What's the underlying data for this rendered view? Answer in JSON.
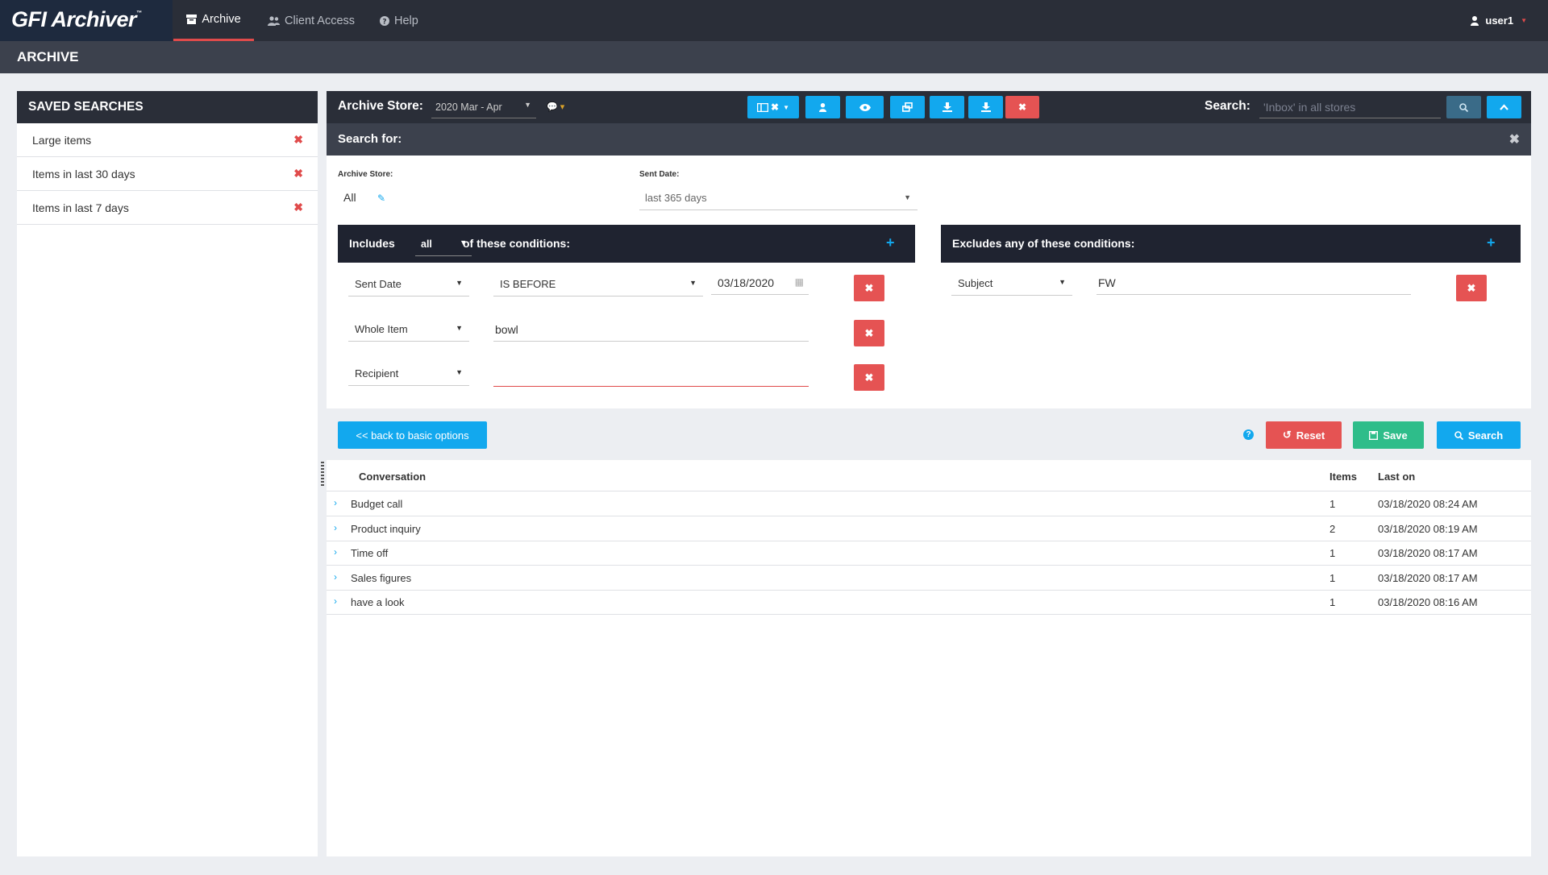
{
  "app": {
    "logo": "GFI Archiver",
    "logo_tm": "™"
  },
  "nav": {
    "tabs": [
      {
        "label": "Archive",
        "icon": "archive-icon",
        "active": true
      },
      {
        "label": "Client Access",
        "icon": "users-icon",
        "active": false
      },
      {
        "label": "Help",
        "icon": "help-circle-icon",
        "active": false
      }
    ],
    "user": "user1"
  },
  "page": {
    "title": "ARCHIVE"
  },
  "sidebar": {
    "title": "SAVED SEARCHES",
    "items": [
      {
        "label": "Large items"
      },
      {
        "label": "Items in last 30 days"
      },
      {
        "label": "Items in last 7 days"
      }
    ]
  },
  "toolbar": {
    "archive_store_label": "Archive Store:",
    "archive_store_value": "2020 Mar - Apr",
    "search_label": "Search:",
    "search_placeholder": "'Inbox' in all stores",
    "buttons": [
      "columns-icon",
      "user-icon",
      "eye-icon",
      "copy-icon",
      "download-icon",
      "export-icon",
      "close-icon"
    ]
  },
  "search_for": {
    "title": "Search for:",
    "archive_store_label": "Archive Store:",
    "archive_store_value": "All",
    "sent_date_label": "Sent Date:",
    "sent_date_value": "last 365 days"
  },
  "includes": {
    "label_pre": "Includes",
    "mode": "all",
    "label_post": "of these conditions:",
    "conditions": [
      {
        "field": "Sent Date",
        "operator": "IS BEFORE",
        "value": "03/18/2020"
      },
      {
        "field": "Whole Item",
        "value": "bowl"
      },
      {
        "field": "Recipient",
        "value": ""
      }
    ]
  },
  "excludes": {
    "label": "Excludes any of these conditions:",
    "conditions": [
      {
        "field": "Subject",
        "value": "FW"
      }
    ]
  },
  "actions": {
    "back": "<< back to basic options",
    "reset": "Reset",
    "save": "Save",
    "search": "Search"
  },
  "results": {
    "columns": {
      "conversation": "Conversation",
      "items": "Items",
      "last_on": "Last on"
    },
    "rows": [
      {
        "conversation": "Budget call",
        "items": "1",
        "last_on": "03/18/2020 08:24 AM"
      },
      {
        "conversation": "Product inquiry",
        "items": "2",
        "last_on": "03/18/2020 08:19 AM"
      },
      {
        "conversation": "Time off",
        "items": "1",
        "last_on": "03/18/2020 08:17 AM"
      },
      {
        "conversation": "Sales figures",
        "items": "1",
        "last_on": "03/18/2020 08:17 AM"
      },
      {
        "conversation": "have a look",
        "items": "1",
        "last_on": "03/18/2020 08:16 AM"
      }
    ]
  },
  "colors": {
    "accent_blue": "#12a8ee",
    "danger_red": "#e55353",
    "success_green": "#2ebd8a",
    "dark_header": "#2a2e38"
  }
}
